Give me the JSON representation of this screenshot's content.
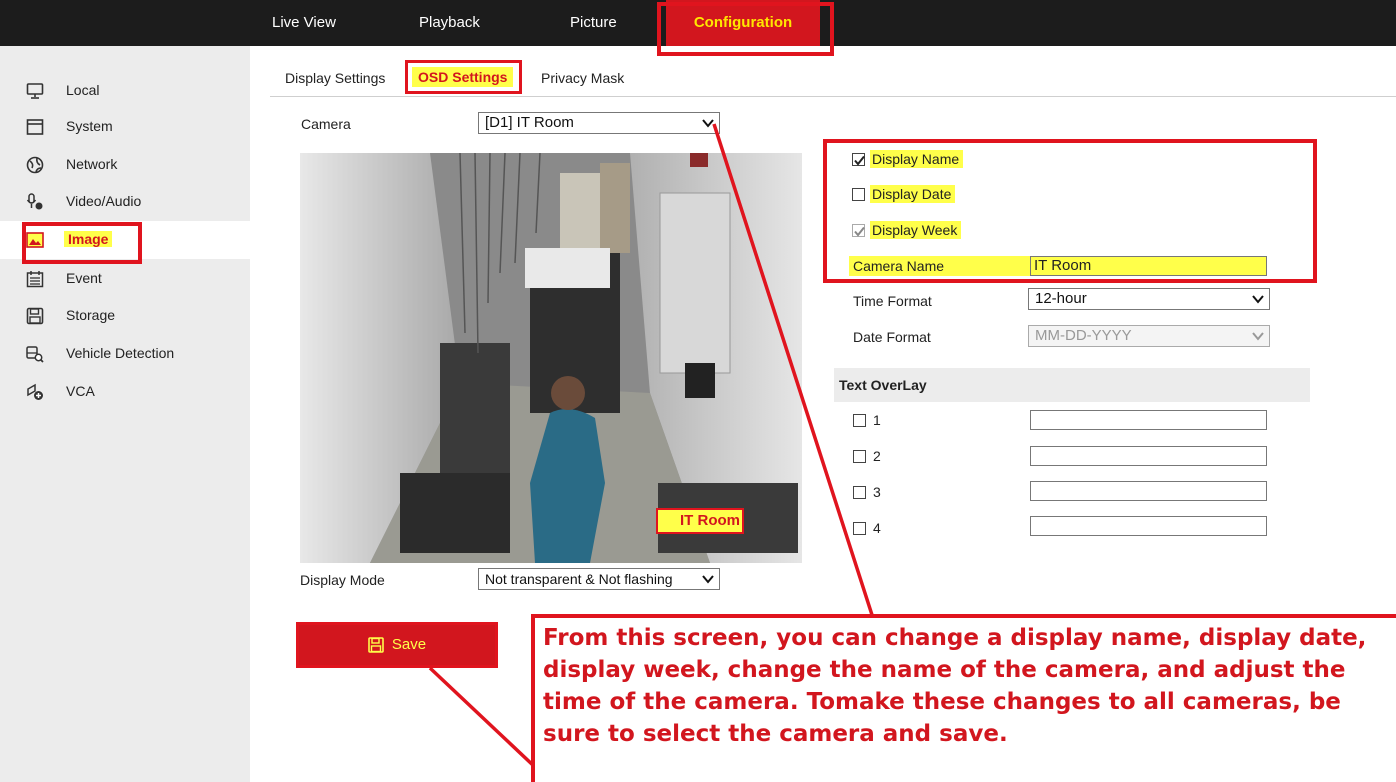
{
  "nav": {
    "items": [
      {
        "label": "Live View"
      },
      {
        "label": "Playback"
      },
      {
        "label": "Picture"
      },
      {
        "label": "Configuration",
        "active": true
      }
    ]
  },
  "sidebar": {
    "items": [
      {
        "label": "Local",
        "icon": "monitor-icon"
      },
      {
        "label": "System",
        "icon": "system-icon"
      },
      {
        "label": "Network",
        "icon": "globe-icon"
      },
      {
        "label": "Video/Audio",
        "icon": "microphone-icon"
      },
      {
        "label": "Image",
        "icon": "image-icon",
        "active": true
      },
      {
        "label": "Event",
        "icon": "calendar-icon"
      },
      {
        "label": "Storage",
        "icon": "disk-icon"
      },
      {
        "label": "Vehicle Detection",
        "icon": "vehicle-search-icon"
      },
      {
        "label": "VCA",
        "icon": "vca-icon"
      }
    ]
  },
  "subtabs": [
    {
      "label": "Display Settings"
    },
    {
      "label": "OSD Settings",
      "active": true
    },
    {
      "label": "Privacy Mask"
    }
  ],
  "form": {
    "camera_label": "Camera",
    "camera_value": "[D1] IT Room",
    "display_mode_label": "Display Mode",
    "display_mode_value": "Not transparent & Not flashing",
    "osd_overlay_text": "IT Room",
    "display_name": {
      "label": "Display Name",
      "checked": true
    },
    "display_date": {
      "label": "Display Date",
      "checked": false
    },
    "display_week": {
      "label": "Display Week",
      "checked": true,
      "disabled": true
    },
    "camera_name_label": "Camera Name",
    "camera_name_value": "IT Room",
    "time_format_label": "Time Format",
    "time_format_value": "12-hour",
    "date_format_label": "Date Format",
    "date_format_value": "MM-DD-YYYY",
    "text_overlay_header": "Text OverLay",
    "text_overlays": [
      {
        "label": "1",
        "value": ""
      },
      {
        "label": "2",
        "value": ""
      },
      {
        "label": "3",
        "value": ""
      },
      {
        "label": "4",
        "value": ""
      }
    ],
    "save_label": "Save"
  },
  "callout": {
    "lines": [
      "From this screen, you can change a display name, display date,",
      "display week, change the name of the camera, and adjust the",
      "time of the camera. Tomake these changes to all cameras, be",
      "sure to select the camera and save."
    ]
  },
  "colors": {
    "accent_red": "#d2161e",
    "highlight_yellow": "#ffff4a",
    "topbar": "#1c1c1c",
    "sidebar": "#ececec"
  }
}
